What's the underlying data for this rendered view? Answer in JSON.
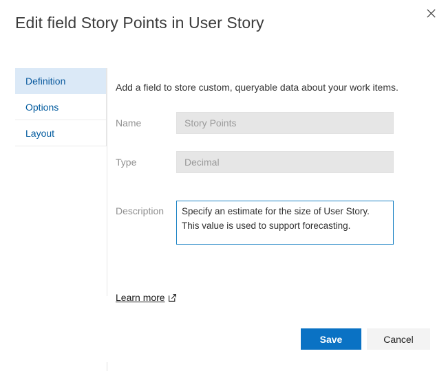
{
  "dialog": {
    "title": "Edit field Story Points in User Story",
    "close_icon": "close-icon"
  },
  "tabs": [
    {
      "label": "Definition",
      "selected": true
    },
    {
      "label": "Options",
      "selected": false
    },
    {
      "label": "Layout",
      "selected": false
    }
  ],
  "content": {
    "intro": "Add a field to store custom, queryable data about your work items.",
    "fields": {
      "name": {
        "label": "Name",
        "value": "Story Points",
        "placeholder": "Story Points",
        "disabled": true
      },
      "type": {
        "label": "Type",
        "value": "Decimal",
        "placeholder": "Decimal",
        "disabled": true
      },
      "description": {
        "label": "Description",
        "value": "Specify an estimate for the size of User Story. This value is used to support forecasting.",
        "placeholder": "Description",
        "focused": true
      }
    },
    "learn_more": {
      "label": "Learn more",
      "icon": "external-link-icon"
    }
  },
  "footer": {
    "save_label": "Save",
    "cancel_label": "Cancel"
  },
  "colors": {
    "accent": "#0a72c4",
    "tab_selected_bg": "#dbe9f7",
    "tab_text": "#005a9e",
    "field_disabled_bg": "#e6e6e6",
    "field_focus_border": "#1b82c4",
    "secondary_button_bg": "#f3f3f3",
    "label_text": "#909090"
  }
}
